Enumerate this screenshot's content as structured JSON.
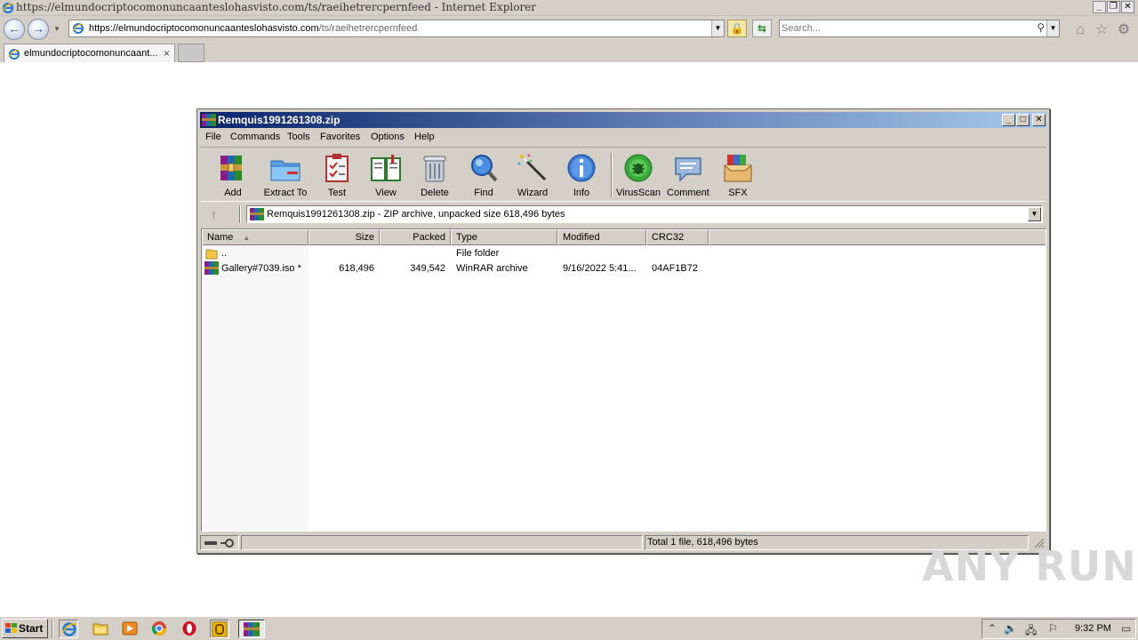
{
  "browser": {
    "title": "https://elmundocriptocomonuncaanteslohasvisto.com/ts/raeihetrercpernfeed - Internet Explorer",
    "address_domain": "https://elmundocriptocomonuncaanteslohasvisto.com",
    "address_path": "/ts/raeihetrercpernfeed",
    "search_placeholder": "Search...",
    "tab_label": "elmundocriptocomonuncaant...",
    "tab_close": "×"
  },
  "winrar": {
    "title": "Remquis1991261308.zip",
    "menu": [
      "File",
      "Commands",
      "Tools",
      "Favorites",
      "Options",
      "Help"
    ],
    "toolbar": [
      "Add",
      "Extract To",
      "Test",
      "View",
      "Delete",
      "Find",
      "Wizard",
      "Info",
      "VirusScan",
      "Comment",
      "SFX"
    ],
    "path_text": "Remquis1991261308.zip - ZIP archive, unpacked size 618,496 bytes",
    "columns": [
      "Name",
      "Size",
      "Packed",
      "Type",
      "Modified",
      "CRC32"
    ],
    "rows": [
      {
        "name": "..",
        "size": "",
        "packed": "",
        "type": "File folder",
        "modified": "",
        "crc": ""
      },
      {
        "name": "Gallery#7039.iso *",
        "size": "618,496",
        "packed": "349,542",
        "type": "WinRAR archive",
        "modified": "9/16/2022 5:41...",
        "crc": "04AF1B72"
      }
    ],
    "status_total": "Total 1 file, 618,496 bytes"
  },
  "watermark": "ANY RUN",
  "taskbar": {
    "start_label": "Start",
    "clock": "9:32 PM"
  },
  "colors": {
    "winrar_title_start": "#0a246a",
    "winrar_title_end": "#a6caf0",
    "classic_face": "#d4d0c8"
  }
}
